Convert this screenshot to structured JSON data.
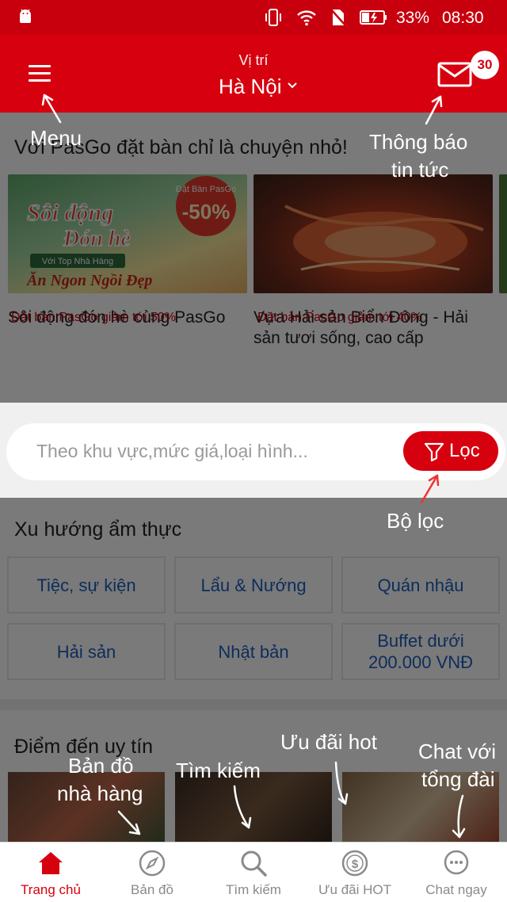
{
  "status_bar": {
    "battery_pct": "33%",
    "time": "08:30"
  },
  "header": {
    "location_label": "Vị trí",
    "city": "Hà Nội",
    "notification_count": "30"
  },
  "promo": {
    "title": "Với PasGo đặt bàn chỉ là chuyện nhỏ!",
    "cards": [
      {
        "name": "Sôi động đón hè cùng PasGo",
        "deal": "Đặt bàn PasGo giảm tới 50%",
        "banner_lines": [
          "Sôi động",
          "Đón hè"
        ],
        "banner_sub": "Với Top Nhà Hàng",
        "banner_slogan": "Ăn Ngon Ngồi Đẹp",
        "banner_badge_top": "Đặt Bàn PasGo",
        "banner_badge": "-50%"
      },
      {
        "name": "Vựa Hải sản Biển Đông - Hải sản tươi sống, cao cấp",
        "deal": "Đặt bàn PasGo giảm tới 40%"
      }
    ]
  },
  "search": {
    "placeholder": "Theo khu vực,mức giá,loại hình...",
    "filter_label": "Lọc"
  },
  "trends": {
    "title": "Xu hướng ẩm thực",
    "categories": [
      "Tiệc, sự kiện",
      "Lẩu & Nướng",
      "Quán nhậu",
      "Hải sản",
      "Nhật bản",
      "Buffet dưới 200.000 VNĐ"
    ]
  },
  "destinations": {
    "title": "Điểm đến uy tín"
  },
  "annotations": {
    "menu": "Menu",
    "notifications_line1": "Thông báo",
    "notifications_line2": "tin tức",
    "filter": "Bộ lọc",
    "map_line1": "Bản đồ",
    "map_line2": "nhà hàng",
    "search": "Tìm kiếm",
    "hot": "Ưu đãi hot",
    "chat_line1": "Chat với",
    "chat_line2": "tổng đài"
  },
  "bottom_nav": [
    {
      "label": "Trang chủ",
      "icon": "home-icon"
    },
    {
      "label": "Bản đồ",
      "icon": "compass-icon"
    },
    {
      "label": "Tìm kiếm",
      "icon": "search-icon"
    },
    {
      "label": "Ưu đãi HOT",
      "icon": "dollar-badge-icon"
    },
    {
      "label": "Chat ngay",
      "icon": "chat-bubble-icon"
    }
  ],
  "colors": {
    "brand_red": "#d7000f",
    "link_blue": "#1f5fbf",
    "deal_red": "#c8000e"
  }
}
